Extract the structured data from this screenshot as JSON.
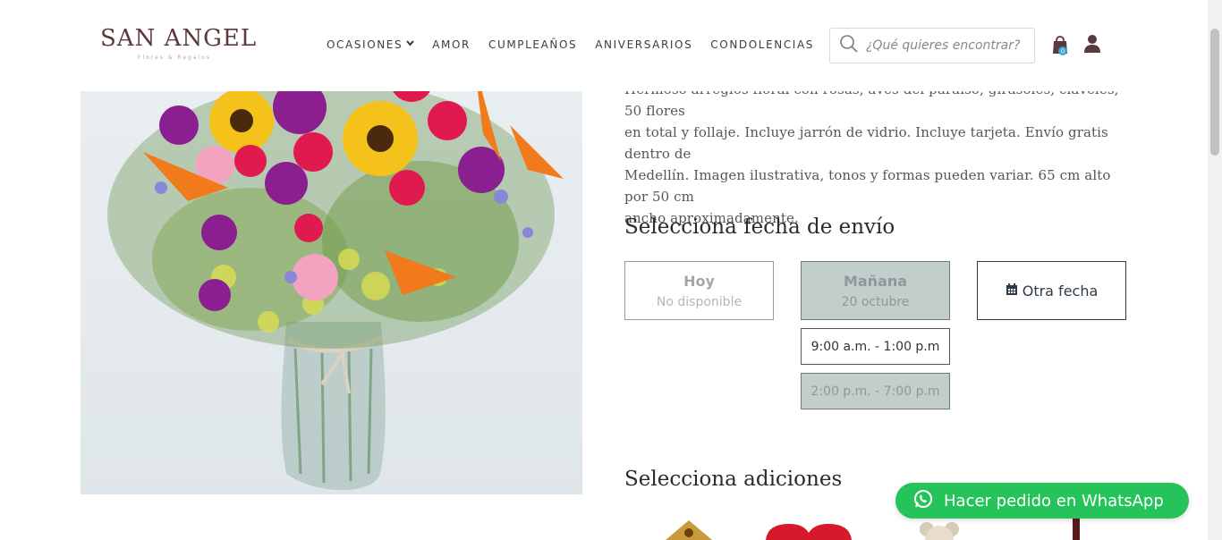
{
  "brand": {
    "name": "SAN ANGEL",
    "tagline": "Flores & Regalos"
  },
  "nav": {
    "items": [
      "OCASIONES",
      "AMOR",
      "CUMPLEAÑOS",
      "ANIVERSARIOS",
      "CONDOLENCIAS"
    ],
    "dropdown_indicator": "chevron-down-icon"
  },
  "search": {
    "placeholder": "¿Qué quieres encontrar?",
    "value": ""
  },
  "cart": {
    "count": "0"
  },
  "product": {
    "description_line1": "Hermoso arreglos floral con rosas, aves del paraíso, girasoles, claveles, 50 flores",
    "description_line2": "en total y follaje. Incluye jarrón de vidrio. Incluye tarjeta. Envío gratis dentro de",
    "description_line3": "Medellín. Imagen ilustrativa, tonos y formas pueden variar. 65 cm alto por 50 cm",
    "description_line4": "ancho aproximadamente."
  },
  "delivery": {
    "title": "Selecciona fecha de envío",
    "options": [
      {
        "label": "Hoy",
        "sub": "No disponible"
      },
      {
        "label": "Mañana",
        "sub": "20 octubre"
      },
      {
        "label": "Otra fecha",
        "sub": ""
      }
    ],
    "slots": [
      "9:00 a.m. - 1:00 p.m",
      "2:00 p.m. - 7:00 p.m"
    ]
  },
  "additions": {
    "title": "Selecciona adiciones"
  },
  "whatsapp": {
    "label": "Hacer pedido en WhatsApp"
  },
  "colors": {
    "brand": "#5a3a3c",
    "selected_fill": "#c3cdcc",
    "whatsapp_green": "#25c35a",
    "other_date_border": "#2e3b46"
  }
}
